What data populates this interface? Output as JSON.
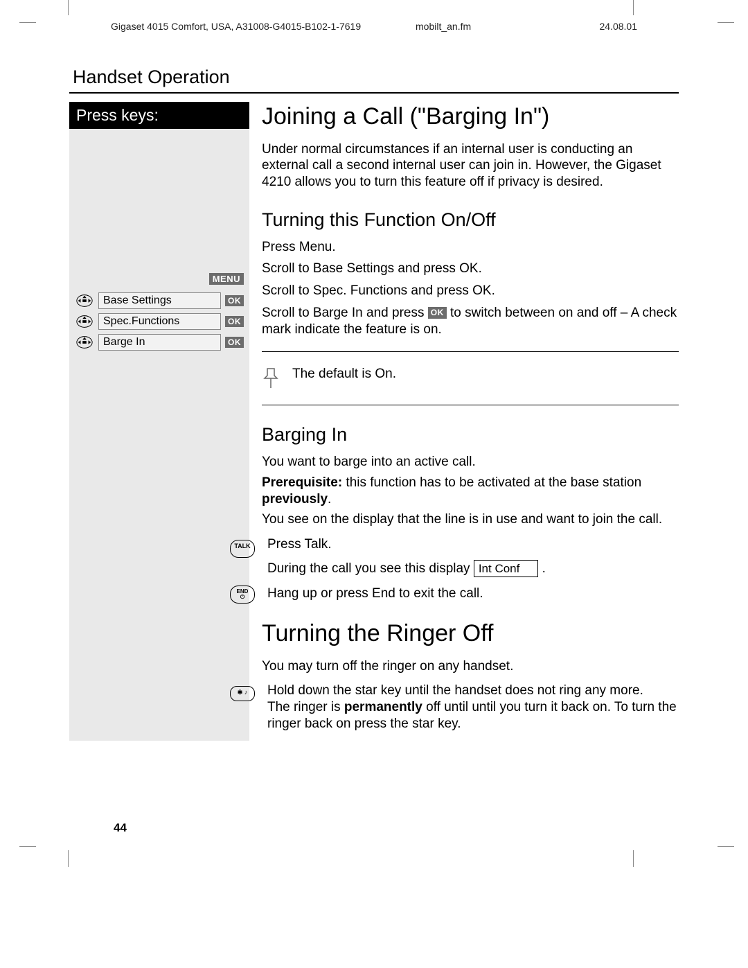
{
  "header": {
    "doc_id": "Gigaset 4015 Comfort, USA, A31008-G4015-B102-1-7619",
    "filename": "mobilt_an.fm",
    "date": "24.08.01"
  },
  "section_title": "Handset Operation",
  "sidebar": {
    "header": "Press keys:",
    "menu_label": "MENU",
    "steps": [
      {
        "label": "Base Settings",
        "ok": "OK"
      },
      {
        "label": "Spec.Functions",
        "ok": "OK"
      },
      {
        "label": "Barge In",
        "ok": "OK"
      }
    ]
  },
  "main": {
    "h1": "Joining a Call (\"Barging In\")",
    "intro": "Under normal circumstances if an internal user is conducting an external call a second internal user can join in.  However, the Gigaset 4210 allows you to turn this feature off if privacy is desired.",
    "h2_onoff": "Turning this Function On/Off",
    "step_menu": "Press Menu.",
    "step_base": "Scroll to Base Settings and press OK.",
    "step_spec": "Scroll to Spec. Functions and press OK.",
    "step_barge_pre": "Scroll to Barge In and press",
    "step_barge_ok": "OK",
    "step_barge_post": "to switch between on and off – A check mark indicate the feature is on.",
    "note_default": "The default is On.",
    "h2_bargingin": "Barging In",
    "barge_p1": "You want to barge into an active call.",
    "barge_prereq_label": "Prerequisite:",
    "barge_prereq_text": " this function has to be activated at the base station ",
    "barge_prereq_bold": "previously",
    "barge_prereq_end": ".",
    "barge_p2": "You see on the display that the line is in use and want to join the call.",
    "press_talk": "Press Talk.",
    "during_call_pre": "During the call you see this display",
    "display_label": "Int Conf",
    "during_call_post": "  .",
    "hang_up": "Hang up or press End to exit the call.",
    "h1_ringer": "Turning the Ringer Off",
    "ringer_p1": "You may turn off the ringer on any handset.",
    "ringer_p2_pre": "Hold down the star key until the handset does not ring any more.\nThe ringer is ",
    "ringer_p2_bold": "permanently",
    "ringer_p2_post": " off until until you turn it back on. To turn the ringer back on press the star key."
  },
  "icons": {
    "talk": "TALK",
    "end": "END",
    "star": "✱ ♪"
  },
  "page_number": "44"
}
